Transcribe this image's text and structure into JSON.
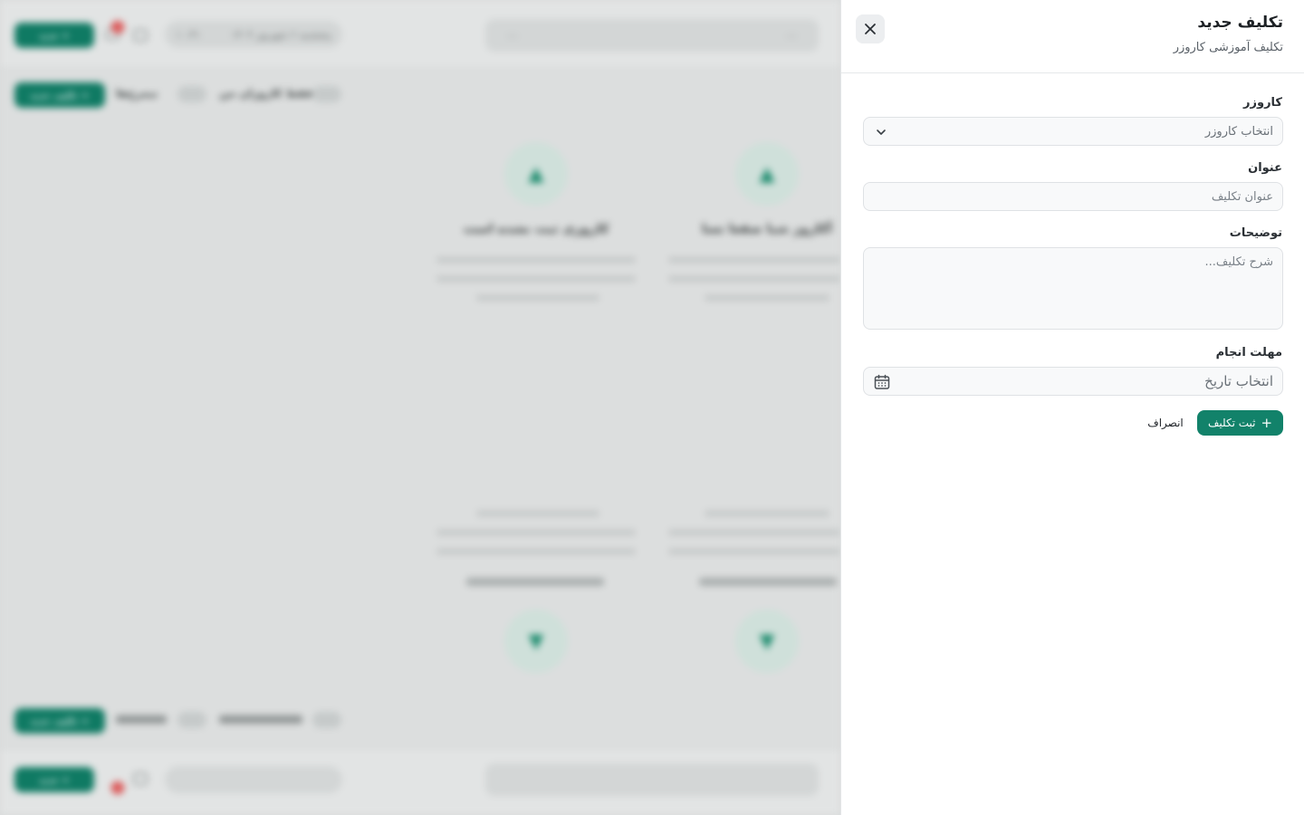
{
  "background": {
    "top_new_button": "+ جدید",
    "top_notifications_count": "3",
    "top_date": "پنجشنبه ۶ شهریور ۱۴۰۴",
    "top_time": "۱۰:۳۱",
    "search_left": "۰:۰",
    "search_right": "۰:۰",
    "toolbar_new_assignment": "+ تکلیف جدید",
    "toolbar_archive_label": "نیمرخ‌ها",
    "toolbar_mine_label": "فقط کاروزان من",
    "card_titles": [
      "کاروزی ثبت نشده است",
      "آکاروز شبا ضقعا تسا"
    ],
    "bottom_new_button": "+ جدید",
    "bottom_notifications_count": "3",
    "bottom_toolbar_new": "+ تکلیف جدید"
  },
  "drawer": {
    "title": "تکلیف جدید",
    "subtitle": "تکلیف آموزشی کاروزر",
    "close_icon": "close-icon",
    "fields": {
      "worker": {
        "label": "کاروزر",
        "placeholder": "انتخاب کاروزر"
      },
      "title": {
        "label": "عنوان",
        "placeholder": "عنوان تکلیف"
      },
      "description": {
        "label": "توضیحات",
        "placeholder": "شرح تکلیف..."
      },
      "deadline": {
        "label": "مهلت انجام",
        "placeholder": "انتخاب تاریخ"
      }
    },
    "submit_label": "ثبت تکلیف",
    "cancel_label": "انصراف"
  },
  "colors": {
    "accent": "#12826a",
    "overlay": "#d9dbdb"
  }
}
